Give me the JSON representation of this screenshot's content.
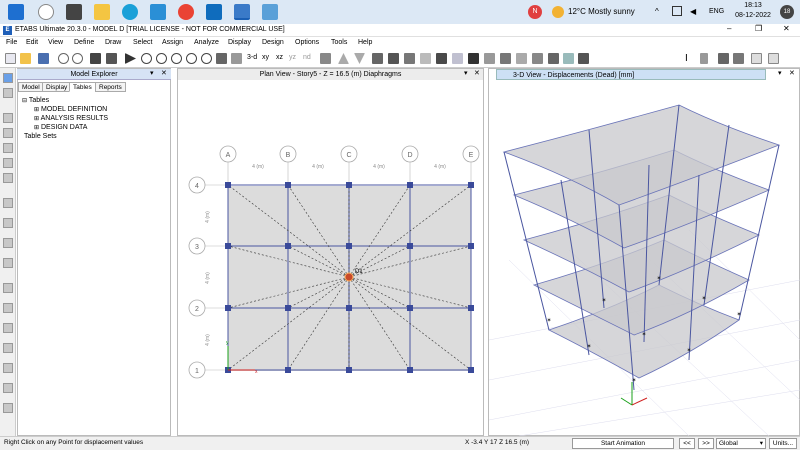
{
  "taskbar": {
    "weather": "12°C  Mostly sunny",
    "lang": "ENG",
    "time": "18:13",
    "date": "08-12-2022",
    "notif_count": "18"
  },
  "window": {
    "title": "ETABS Ultimate 20.3.0 - MODEL D  [TRIAL LICENSE - NOT FOR COMMERCIAL USE]"
  },
  "menu": [
    "File",
    "Edit",
    "View",
    "Define",
    "Draw",
    "Select",
    "Assign",
    "Analyze",
    "Display",
    "Design",
    "Options",
    "Tools",
    "Help"
  ],
  "explorer": {
    "title": "Model Explorer",
    "tabs": [
      "Model",
      "Display",
      "Tables",
      "Reports"
    ],
    "tree": [
      "Tables",
      "MODEL DEFINITION",
      "ANALYSIS RESULTS",
      "DESIGN DATA",
      "Table Sets"
    ]
  },
  "plan": {
    "title": "Plan View - Story5 - Z = 16.5 (m)  Diaphragms",
    "col_labels": [
      "A",
      "B",
      "C",
      "D",
      "E"
    ],
    "row_labels": [
      "4",
      "3",
      "2",
      "1"
    ],
    "span_labels": [
      "4 (m)",
      "4 (m)",
      "4 (m)",
      "4 (m)"
    ],
    "vspan_labels": [
      "4 (m)",
      "4 (m)",
      "4 (m)"
    ],
    "diaphragm_label": "D1"
  },
  "view3d": {
    "title": "3-D View  - Displacements (Dead)  [mm]"
  },
  "status": {
    "hint": "Right Click on any Point for displacement values",
    "coords": "X -3.4  Y 17  Z 16.5 (m)",
    "start_anim": "Start Animation",
    "prev": "<<",
    "next": ">>",
    "coord_sys": "Global",
    "units": "Units..."
  }
}
